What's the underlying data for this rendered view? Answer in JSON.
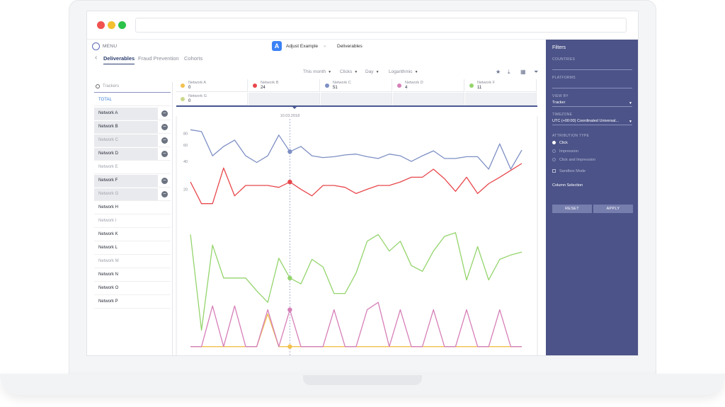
{
  "app": {
    "menu_label": "MENU",
    "name": "Adjust Example",
    "breadcrumb_sep": "»",
    "page": "Deliverables"
  },
  "tabs": [
    {
      "label": "Deliverables",
      "active": true
    },
    {
      "label": "Fraud Prevention",
      "active": false
    },
    {
      "label": "Cohorts",
      "active": false
    }
  ],
  "toolbar": {
    "period": "This month",
    "metric": "Clicks",
    "granularity": "Day",
    "scale": "Logarithmic"
  },
  "sidebar": {
    "search_placeholder": "Trackers",
    "total_label": "TOTAL",
    "networks": [
      {
        "name": "Network A",
        "selected": true,
        "muted": false
      },
      {
        "name": "Network B",
        "selected": true,
        "muted": false
      },
      {
        "name": "Network C",
        "selected": true,
        "muted": true
      },
      {
        "name": "Network D",
        "selected": true,
        "muted": false
      },
      {
        "name": "Network E",
        "selected": false,
        "muted": true
      },
      {
        "name": "Network F",
        "selected": true,
        "muted": false
      },
      {
        "name": "Network G",
        "selected": true,
        "muted": true
      },
      {
        "name": "Network H",
        "selected": false,
        "muted": false
      },
      {
        "name": "Network I",
        "selected": false,
        "muted": true
      },
      {
        "name": "Network K",
        "selected": false,
        "muted": false
      },
      {
        "name": "Network L",
        "selected": false,
        "muted": false
      },
      {
        "name": "Network M",
        "selected": false,
        "muted": true
      },
      {
        "name": "Network N",
        "selected": false,
        "muted": false
      },
      {
        "name": "Network O",
        "selected": false,
        "muted": false
      },
      {
        "name": "Network P",
        "selected": false,
        "muted": false
      }
    ]
  },
  "legend": [
    {
      "name": "Network A",
      "value": "0",
      "color": "#f2c14e"
    },
    {
      "name": "Network B",
      "value": "24",
      "color": "#e8474c"
    },
    {
      "name": "Network C",
      "value": "51",
      "color": "#7d8fc4"
    },
    {
      "name": "Network D",
      "value": "4",
      "color": "#d67fb8"
    },
    {
      "name": "Network F",
      "value": "11",
      "color": "#94d46c"
    },
    {
      "name": "Network G",
      "value": "0",
      "color": "#c9d98a"
    }
  ],
  "chart_data": {
    "type": "line",
    "marker_label": "10.03.2018",
    "marker_index": 9,
    "yticks": [
      20,
      40,
      60,
      80
    ],
    "y_scale": "log",
    "ylim": [
      0.3,
      100
    ],
    "x": [
      1,
      2,
      3,
      4,
      5,
      6,
      7,
      8,
      9,
      10,
      11,
      12,
      13,
      14,
      15,
      16,
      17,
      18,
      19,
      20,
      21,
      22,
      23,
      24,
      25,
      26,
      27,
      28,
      29,
      30,
      31
    ],
    "series": [
      {
        "name": "Network C",
        "color": "#7d8fc4",
        "values": [
          88,
          84,
          46,
          58,
          68,
          46,
          39,
          46,
          77,
          51,
          58,
          46,
          44,
          45,
          47,
          48,
          45,
          43,
          48,
          46,
          40,
          46,
          52,
          43,
          43,
          45,
          45,
          33,
          62,
          33,
          53
        ]
      },
      {
        "name": "Network B",
        "color": "#e8474c",
        "values": [
          24,
          14,
          14,
          34,
          17,
          22,
          22,
          22,
          21,
          24,
          20,
          17,
          22,
          22,
          21,
          18,
          20,
          22,
          22,
          24,
          27,
          27,
          33,
          26,
          19,
          27,
          18,
          23,
          27,
          32,
          38
        ]
      },
      {
        "name": "Network F",
        "color": "#94d46c",
        "values": [
          6.5,
          0.6,
          5,
          2.2,
          2.2,
          2.2,
          1.6,
          1.2,
          3.6,
          2.2,
          1.9,
          3.5,
          2.9,
          1.5,
          1.5,
          2.5,
          5.5,
          6.5,
          4.3,
          5.5,
          3.0,
          2.6,
          4.3,
          6.2,
          6.8,
          2.1,
          4.8,
          2.1,
          3.5,
          3.9,
          4.2
        ]
      },
      {
        "name": "Network D",
        "color": "#d67fb8",
        "values": [
          0.4,
          0.4,
          1.1,
          0.4,
          1.1,
          0.4,
          0.4,
          1.0,
          0.4,
          1.0,
          0.4,
          0.4,
          0.4,
          1.0,
          0.4,
          0.4,
          1.0,
          1.2,
          0.4,
          1.0,
          0.4,
          0.4,
          1.0,
          0.4,
          0.4,
          1.0,
          0.4,
          0.4,
          1.0,
          0.4,
          0.4
        ]
      },
      {
        "name": "Network A",
        "color": "#f2c14e",
        "values": [
          0.4,
          0.4,
          0.4,
          0.4,
          0.4,
          0.4,
          0.4,
          0.9,
          0.4,
          0.4,
          0.4,
          0.4,
          0.4,
          0.4,
          0.4,
          0.4,
          0.4,
          0.4,
          0.4,
          0.4,
          0.4,
          0.4,
          0.4,
          0.4,
          0.4,
          0.4,
          0.4,
          0.4,
          0.4,
          0.4,
          0.4
        ]
      }
    ]
  },
  "filters": {
    "title": "Filters",
    "countries_label": "COUNTRIES",
    "platforms_label": "PLATFORMS",
    "view_by_label": "VIEW BY",
    "view_by_value": "Tracker",
    "timezone_label": "TIMEZONE",
    "timezone_value": "UTC (+00:00) Coordinated Universal...",
    "attribution_label": "ATTRIBUTION TYPE",
    "attribution_options": [
      {
        "label": "Click",
        "selected": true
      },
      {
        "label": "Impression",
        "selected": false
      },
      {
        "label": "Click and Impression",
        "selected": false
      }
    ],
    "sandbox_label": "Sandbox Mode",
    "column_selection": "Column Selection",
    "reset_label": "RESET",
    "apply_label": "APPLY"
  }
}
